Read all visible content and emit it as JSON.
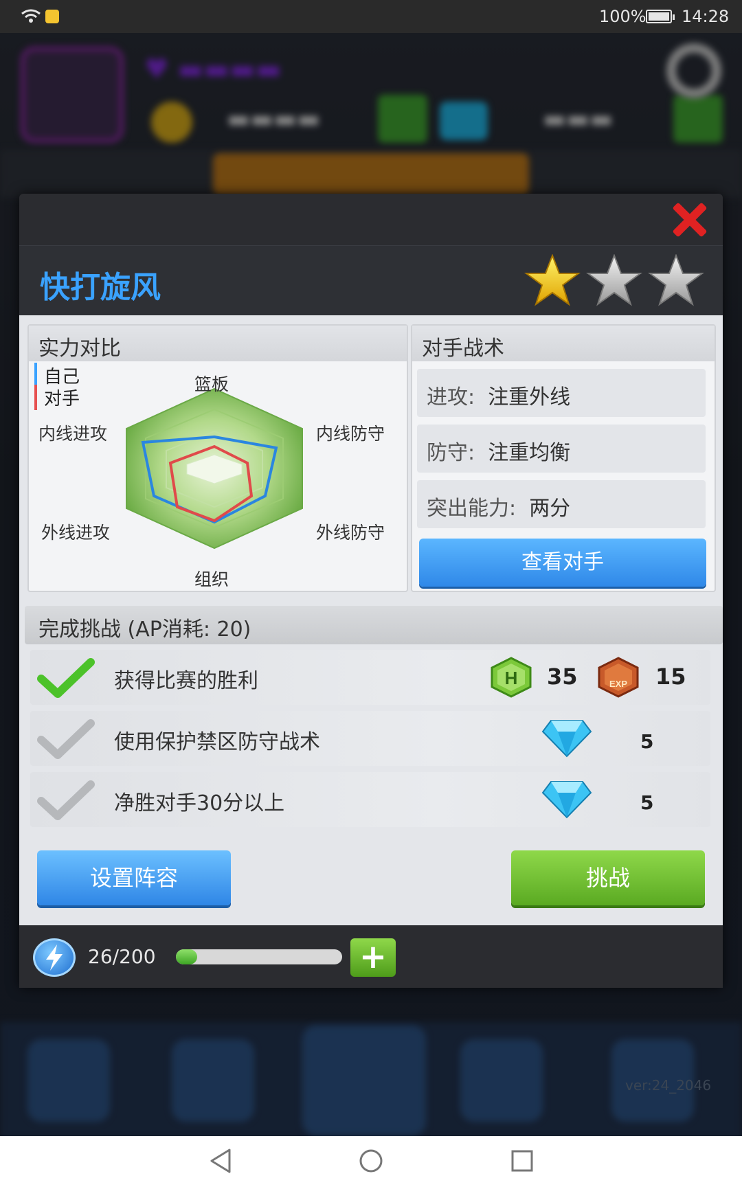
{
  "status_bar": {
    "battery": "100%",
    "time": "14:28"
  },
  "background": {
    "app_version": "ver:24_2046"
  },
  "dialog": {
    "title": "快打旋风",
    "stars_filled": 1,
    "stars_total": 3,
    "strength_panel": {
      "heading": "实力对比",
      "legend_self": "自己",
      "legend_opponent": "对手",
      "axes": [
        "篮板",
        "内线防守",
        "外线防守",
        "组织",
        "外线进攻",
        "内线进攻"
      ]
    },
    "tactics_panel": {
      "heading": "对手战术",
      "rows": [
        {
          "key": "进攻:",
          "value": "注重外线"
        },
        {
          "key": "防守:",
          "value": "注重均衡"
        },
        {
          "key": "突出能力:",
          "value": "两分"
        }
      ],
      "view_button": "查看对手"
    },
    "challenge_section": {
      "heading": "完成挑战 (AP消耗: 20)",
      "tasks": [
        {
          "text": "获得比赛的胜利",
          "completed": true,
          "rewards": [
            {
              "icon": "h-coin-icon",
              "amount": "35"
            },
            {
              "icon": "exp-icon",
              "amount": "15"
            }
          ]
        },
        {
          "text": "使用保护禁区防守战术",
          "completed": false,
          "rewards": [
            {
              "icon": "diamond-icon",
              "amount": "5"
            }
          ]
        },
        {
          "text": "净胜对手30分以上",
          "completed": false,
          "rewards": [
            {
              "icon": "diamond-icon",
              "amount": "5"
            }
          ]
        }
      ]
    },
    "buttons": {
      "lineup": "设置阵容",
      "challenge": "挑战"
    },
    "ap": {
      "text": "26/200",
      "progress": 0.13
    }
  },
  "colors": {
    "accent_blue": "#3aa2ff",
    "close_red": "#e02222",
    "green_button": "#6cbf30"
  }
}
